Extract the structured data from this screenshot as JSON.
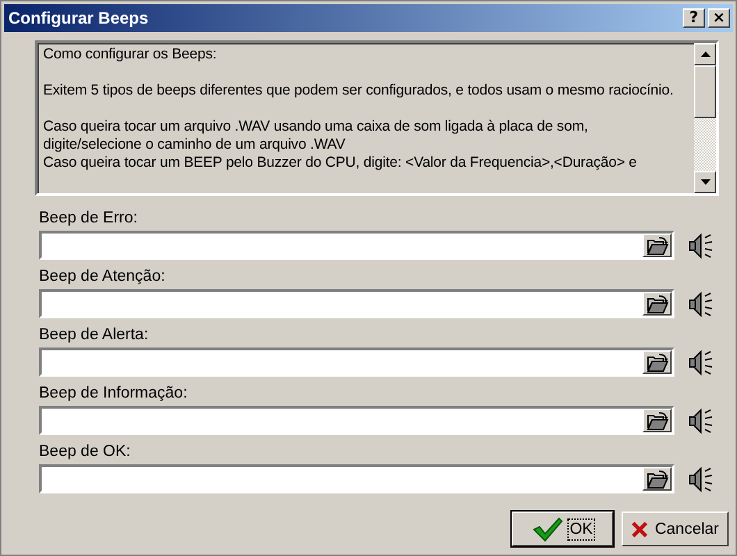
{
  "window": {
    "title": "Configurar Beeps",
    "title_buttons": [
      "?",
      "×"
    ]
  },
  "help_text": [
    "Como configurar os Beeps:",
    "Exitem 5 tipos de beeps diferentes que podem ser configurados, e todos usam o mesmo raciocínio.",
    "Caso queira tocar um arquivo .WAV usando uma caixa de som ligada à placa de som, digite/selecione o caminho de um arquivo .WAV\nCaso queira tocar um BEEP pelo Buzzer do CPU, digite: <Valor da Frequencia>,<Duração> e"
  ],
  "beeps": [
    {
      "label": "Beep de Erro:"
    },
    {
      "label": "Beep de Atenção:"
    },
    {
      "label": "Beep de Alerta:"
    },
    {
      "label": "Beep de Informação:"
    },
    {
      "label": "Beep de OK:"
    }
  ],
  "buttons": [
    {
      "label": "OK",
      "kind": "ok",
      "default": true
    },
    {
      "label": "Cancelar",
      "kind": "cancel",
      "default": false
    }
  ]
}
